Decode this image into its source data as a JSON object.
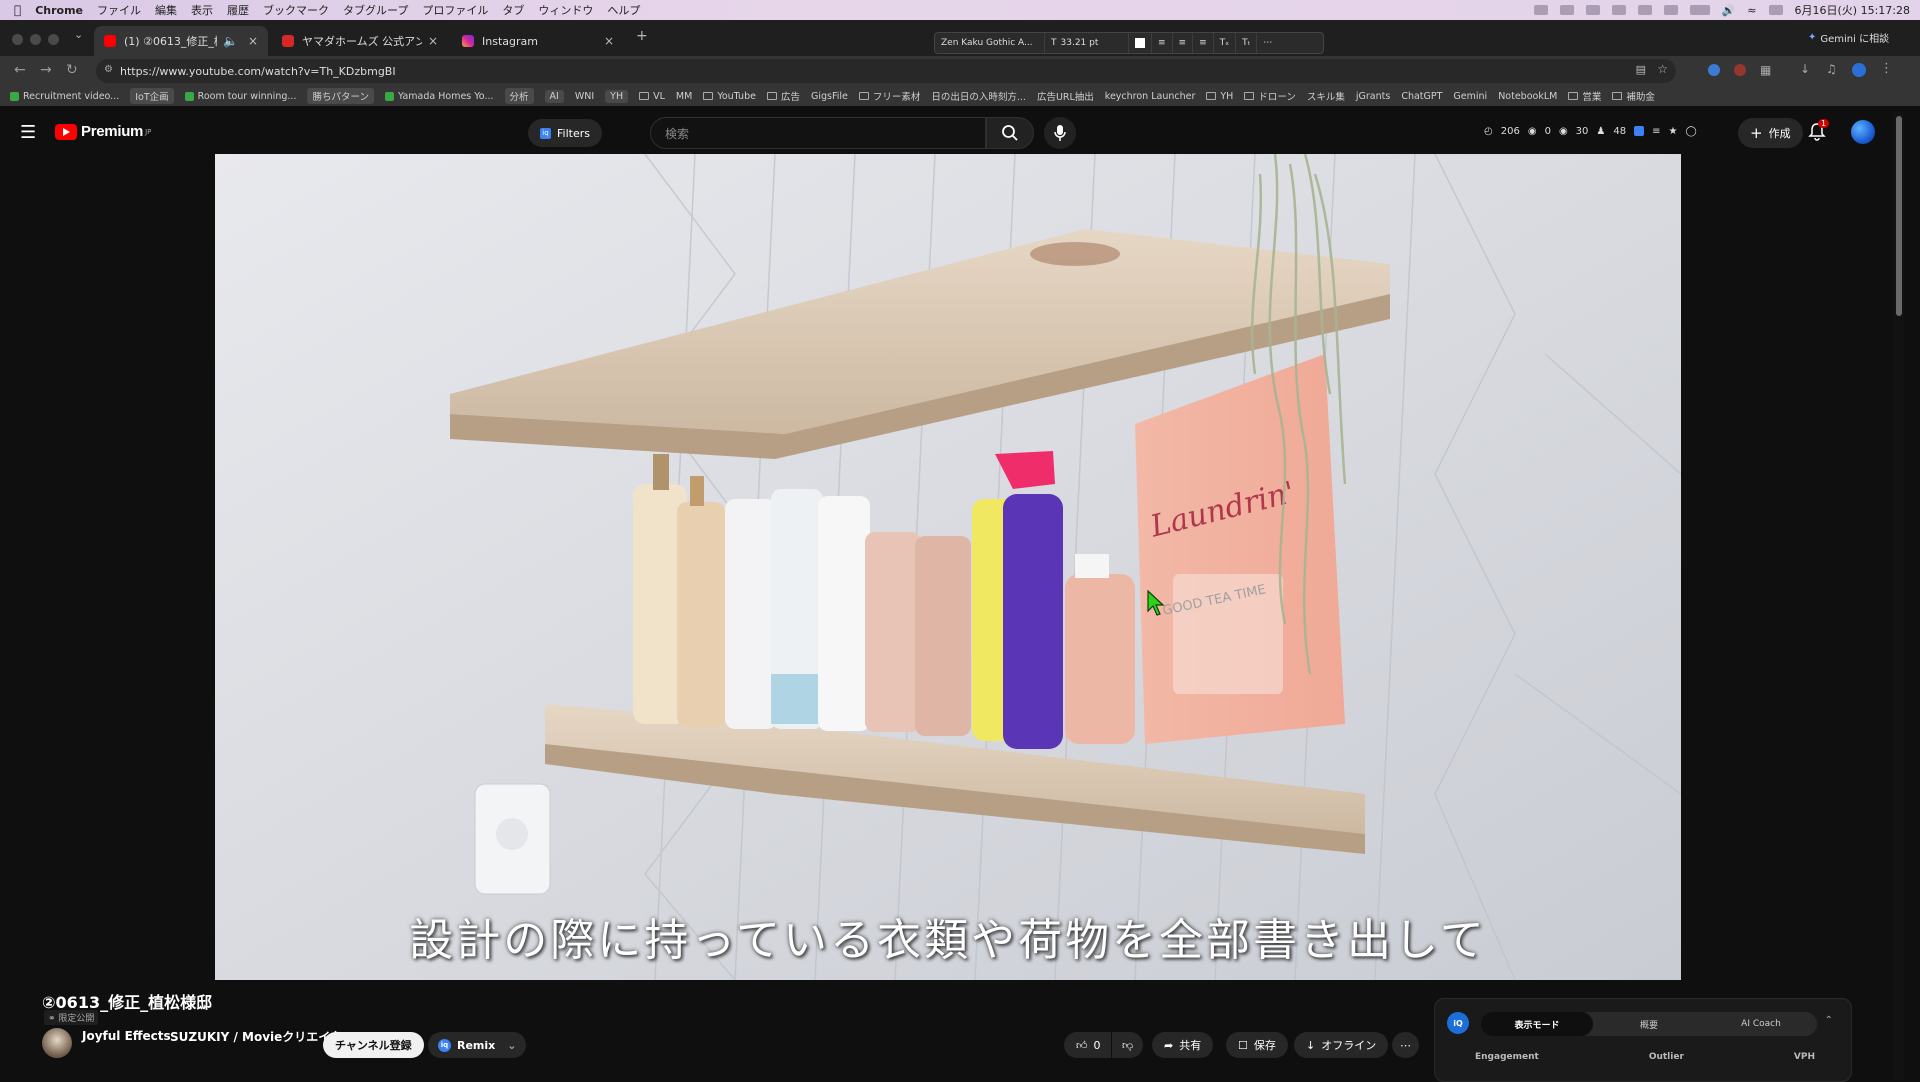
{
  "menubar": {
    "app": "Chrome",
    "items": [
      "ファイル",
      "編集",
      "表示",
      "履歴",
      "ブックマーク",
      "タブグループ",
      "プロファイル",
      "タブ",
      "ウィンドウ",
      "ヘルプ"
    ],
    "datetime": "6月16日(火) 15:17:28"
  },
  "tabs": [
    {
      "title": "(1) ②0613_修正_植松様邸",
      "color": "#ff0000"
    },
    {
      "title": "ヤマダホームズ 公式アンバサダ-",
      "color": "#d62828"
    },
    {
      "title": "Instagram",
      "color": "#d6249f"
    }
  ],
  "text_toolbar": {
    "font": "Zen Kaku Gothic A...",
    "size": "33.21 pt"
  },
  "gemini_button": "Gemini に相談",
  "address": {
    "url": "https://www.youtube.com/watch?v=Th_KDzbmgBI"
  },
  "bookmarks": [
    {
      "label": "Recruitment video...",
      "kind": "check"
    },
    {
      "label": "IoT企画",
      "kind": "chip"
    },
    {
      "label": "Room tour winning...",
      "kind": "check"
    },
    {
      "label": "勝ちパターン",
      "kind": "chip"
    },
    {
      "label": "Yamada Homes Yo...",
      "kind": "check"
    },
    {
      "label": "分析",
      "kind": "chip"
    },
    {
      "label": "AI",
      "kind": "chip"
    },
    {
      "label": "WNI",
      "kind": "plain"
    },
    {
      "label": "YH",
      "kind": "chip"
    },
    {
      "label": "VL",
      "kind": "folder"
    },
    {
      "label": "MM",
      "kind": "plain"
    },
    {
      "label": "YouTube",
      "kind": "folder"
    },
    {
      "label": "広告",
      "kind": "folder"
    },
    {
      "label": "GigsFile",
      "kind": "plain"
    },
    {
      "label": "フリー素材",
      "kind": "folder"
    },
    {
      "label": "日の出日の入時刻方...",
      "kind": "plain"
    },
    {
      "label": "広告URL抽出",
      "kind": "plain"
    },
    {
      "label": "keychron Launcher",
      "kind": "plain"
    },
    {
      "label": "YH",
      "kind": "folder"
    },
    {
      "label": "ドローン",
      "kind": "folder"
    },
    {
      "label": "スキル集",
      "kind": "plain"
    },
    {
      "label": "jGrants",
      "kind": "plain"
    },
    {
      "label": "ChatGPT",
      "kind": "plain"
    },
    {
      "label": "Gemini",
      "kind": "plain"
    },
    {
      "label": "NotebookLM",
      "kind": "plain"
    },
    {
      "label": "営業",
      "kind": "folder"
    },
    {
      "label": "補助金",
      "kind": "folder"
    }
  ],
  "youtube": {
    "logo": "Premium",
    "logo_region": "JP",
    "filters_label": "Filters",
    "search_placeholder": "検索",
    "stats": [
      "206",
      "0",
      "30",
      "48"
    ],
    "create_label": "作成",
    "notifications": "1"
  },
  "video": {
    "subtitle": "設計の際に持っている衣類や荷物を全部書き出して",
    "product_label": "Laundrin'",
    "product_sub": "GOOD TEA TIME"
  },
  "below": {
    "title": "②0613_修正_植松様邸",
    "visibility": "限定公開",
    "channel_1": "Joyful Effects",
    "channel_2": "SUZUKIY / Movieクリエイター",
    "subscribe": "チャンネル登録",
    "remix": "Remix",
    "likes": "0",
    "share": "共有",
    "save": "保存",
    "offline": "オフライン"
  },
  "panel": {
    "tabs": [
      "表示モード",
      "概要",
      "AI Coach"
    ],
    "metrics": [
      "Engagement",
      "Outlier",
      "VPH"
    ]
  }
}
